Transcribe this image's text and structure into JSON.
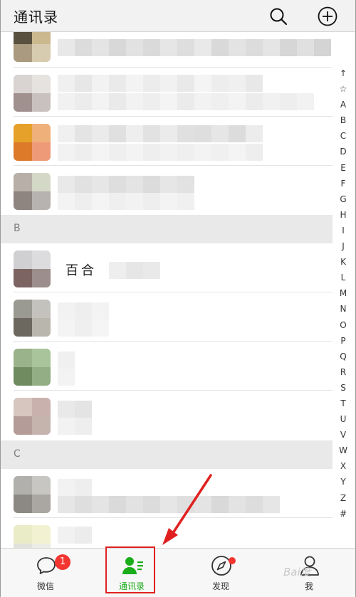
{
  "header": {
    "title": "通讯录",
    "search_icon": "search-icon",
    "add_icon": "plus-circle-icon"
  },
  "sections": [
    {
      "letter": "B"
    },
    {
      "letter": "C"
    }
  ],
  "contacts": [
    {
      "name": "百合"
    }
  ],
  "index_letters": [
    "↑",
    "☆",
    "A",
    "B",
    "C",
    "D",
    "E",
    "F",
    "G",
    "H",
    "I",
    "J",
    "K",
    "L",
    "M",
    "N",
    "O",
    "P",
    "Q",
    "R",
    "S",
    "T",
    "U",
    "V",
    "W",
    "X",
    "Y",
    "Z",
    "#"
  ],
  "tabs": [
    {
      "label": "微信",
      "icon": "chat-bubble-icon",
      "badge": "1"
    },
    {
      "label": "通讯录",
      "icon": "contacts-icon",
      "active": true
    },
    {
      "label": "发现",
      "icon": "compass-icon",
      "dot": true
    },
    {
      "label": "我",
      "icon": "person-icon"
    }
  ],
  "colors": {
    "accent": "#1aad19",
    "badge": "#f43530",
    "annotation": "#e02020"
  }
}
